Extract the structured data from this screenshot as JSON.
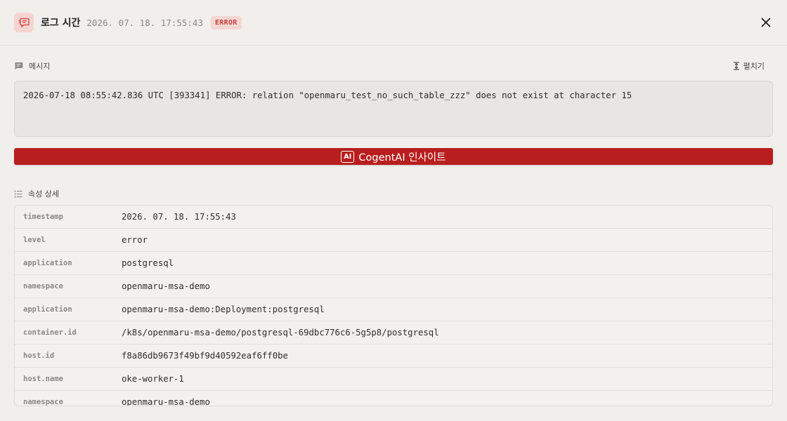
{
  "header": {
    "icon": "message-log-icon",
    "title": "로그 시간",
    "timestamp": "2026. 07. 18. 17:55:43",
    "badge": "ERROR",
    "close_icon": "close-icon"
  },
  "message_section": {
    "icon": "message-icon",
    "label": "메시지",
    "expand_icon": "expand-vertical-icon",
    "expand_label": "펼치기",
    "text": "2026-07-18 08:55:42.836 UTC [393341] ERROR: relation \"openmaru_test_no_such_table_zzz\" does not exist at character 15"
  },
  "ai_button": {
    "icon_text": "AI",
    "label": "CogentAI 인사이트"
  },
  "attributes_section": {
    "icon": "list-icon",
    "label": "속성 상세",
    "rows": [
      {
        "key": "timestamp",
        "value": "2026. 07. 18. 17:55:43"
      },
      {
        "key": "level",
        "value": "error"
      },
      {
        "key": "application",
        "value": "postgresql"
      },
      {
        "key": "namespace",
        "value": "openmaru-msa-demo"
      },
      {
        "key": "application",
        "value": "openmaru-msa-demo:Deployment:postgresql"
      },
      {
        "key": "container.id",
        "value": "/k8s/openmaru-msa-demo/postgresql-69dbc776c6-5g5p8/postgresql"
      },
      {
        "key": "host.id",
        "value": "f8a86db9673f49bf9d40592eaf6ff0be"
      },
      {
        "key": "host.name",
        "value": "oke-worker-1"
      },
      {
        "key": "namespace",
        "value": "openmaru-msa-demo"
      }
    ]
  },
  "colors": {
    "accent_red": "#b81e1e",
    "badge_bg": "#f6d6d2",
    "badge_text": "#c0453d",
    "background": "#f1efec"
  }
}
